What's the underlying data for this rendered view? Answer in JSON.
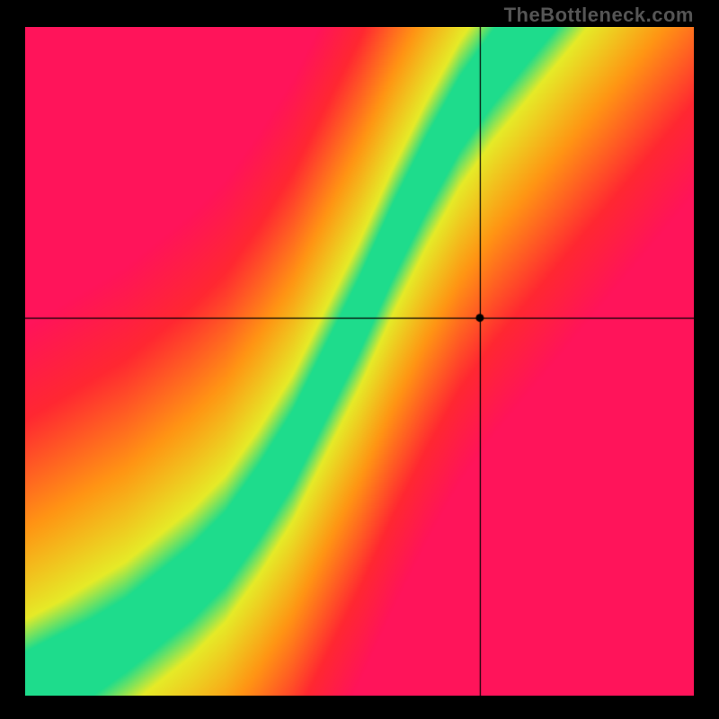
{
  "watermark": "TheBottleneck.com",
  "chart_data": {
    "type": "heatmap",
    "title": "",
    "xlabel": "",
    "ylabel": "",
    "xlim": [
      0,
      1
    ],
    "ylim": [
      0,
      1
    ],
    "grid": false,
    "colorscale": "red-yellow-green",
    "crosshair": {
      "x": 0.68,
      "y": 0.565
    },
    "ideal_curve_description": "Optimal GPU/CPU balance curve (no bottleneck) rising from bottom-left to top-right with an S-shape",
    "ideal_curve": [
      {
        "x": 0.0,
        "y": 0.0
      },
      {
        "x": 0.05,
        "y": 0.03
      },
      {
        "x": 0.1,
        "y": 0.06
      },
      {
        "x": 0.15,
        "y": 0.09
      },
      {
        "x": 0.2,
        "y": 0.13
      },
      {
        "x": 0.25,
        "y": 0.17
      },
      {
        "x": 0.3,
        "y": 0.22
      },
      {
        "x": 0.35,
        "y": 0.29
      },
      {
        "x": 0.4,
        "y": 0.37
      },
      {
        "x": 0.45,
        "y": 0.47
      },
      {
        "x": 0.5,
        "y": 0.57
      },
      {
        "x": 0.55,
        "y": 0.68
      },
      {
        "x": 0.6,
        "y": 0.78
      },
      {
        "x": 0.65,
        "y": 0.87
      },
      {
        "x": 0.7,
        "y": 0.94
      },
      {
        "x": 0.75,
        "y": 1.0
      }
    ],
    "band_half_width": 0.05,
    "marker": {
      "x": 0.68,
      "y": 0.565,
      "value_note": "selected configuration point (off the green band, in orange/yellow transition)"
    }
  }
}
